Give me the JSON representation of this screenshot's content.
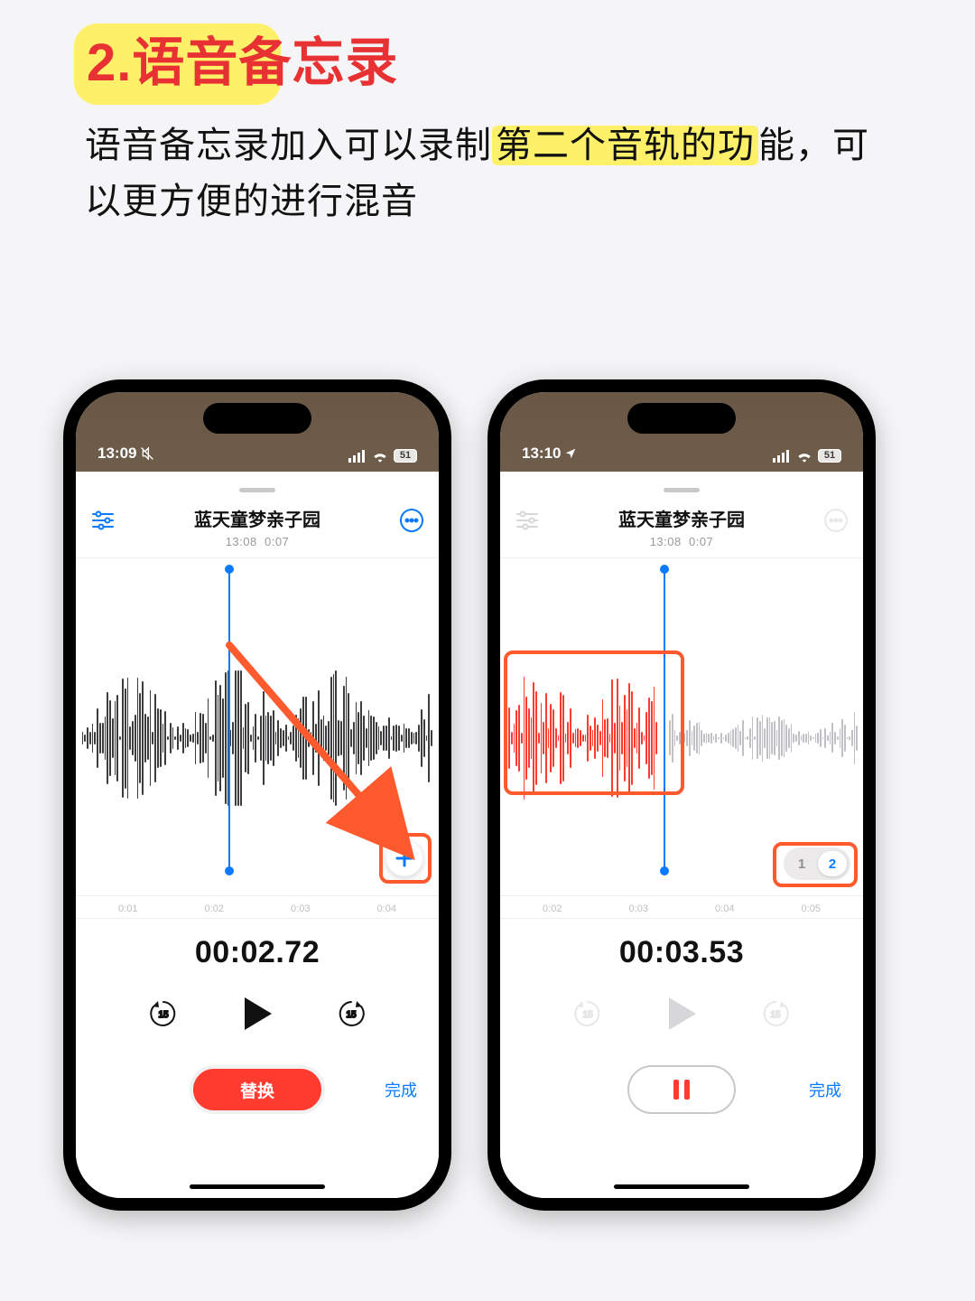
{
  "page": {
    "heading": "2.语音备忘录",
    "sub_part1": "语音备忘录加入可以录制",
    "sub_hl": "第二个音轨的功",
    "sub_part2": "能，可以更方便的进行混音"
  },
  "colors": {
    "accent": "#0a7aff",
    "danger": "#ff3b30",
    "highlight": "#fff06a",
    "annot": "#ff5a2e"
  },
  "left": {
    "status": {
      "time": "13:09",
      "battery": "51"
    },
    "recording": {
      "title": "蓝天童梦亲子园",
      "meta_time": "13:08",
      "meta_dur": "0:07"
    },
    "ruler": [
      "0:01",
      "0:02",
      "0:03",
      "0:04"
    ],
    "playhead_pct": 42,
    "big_time": "00:02.72",
    "replace": "替换",
    "done": "完成",
    "skip_seconds": "15"
  },
  "right": {
    "status": {
      "time": "13:10",
      "battery": "51"
    },
    "recording": {
      "title": "蓝天童梦亲子园",
      "meta_time": "13:08",
      "meta_dur": "0:07"
    },
    "ruler": [
      "0:02",
      "0:03",
      "0:04",
      "0:05"
    ],
    "playhead_pct": 45,
    "big_time": "00:03.53",
    "tracks": {
      "a": "1",
      "b": "2"
    },
    "done": "完成",
    "skip_seconds": "15"
  }
}
